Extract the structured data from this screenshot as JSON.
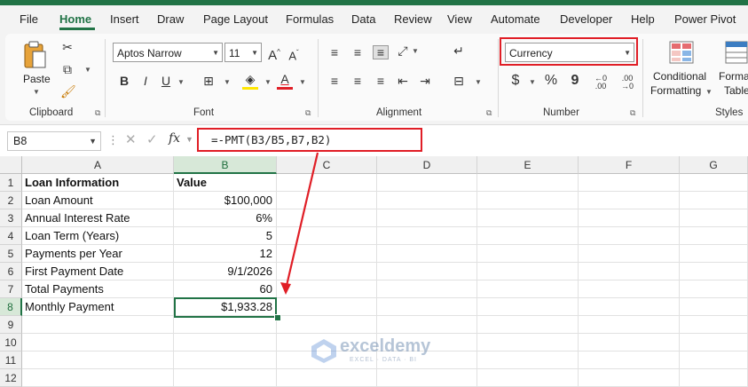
{
  "tabs": [
    "File",
    "Home",
    "Insert",
    "Draw",
    "Page Layout",
    "Formulas",
    "Data",
    "Review",
    "View",
    "Automate",
    "Developer",
    "Help",
    "Power Pivot"
  ],
  "active_tab": "Home",
  "ribbon": {
    "clipboard": {
      "label": "Clipboard",
      "paste_label": "Paste"
    },
    "font": {
      "label": "Font",
      "font_name": "Aptos Narrow",
      "font_size": "11"
    },
    "alignment": {
      "label": "Alignment"
    },
    "number": {
      "label": "Number",
      "format": "Currency",
      "currency_symbol": "$",
      "percent_symbol": "%",
      "comma_symbol": "9"
    },
    "styles": {
      "label": "Styles",
      "conditional_formatting": "Conditional",
      "conditional_formatting_2": "Formatting",
      "format_table": "Forma",
      "format_table_2": "Table"
    }
  },
  "formula_bar": {
    "name_box": "B8",
    "fx": "fx",
    "formula": "=-PMT(B3/B5,B7,B2)"
  },
  "columns": [
    "A",
    "B",
    "C",
    "D",
    "E",
    "F",
    "G"
  ],
  "rows": [
    [
      "Loan Information",
      "Value"
    ],
    [
      "Loan Amount",
      "$100,000"
    ],
    [
      "Annual Interest Rate",
      "6%"
    ],
    [
      "Loan Term (Years)",
      "5"
    ],
    [
      "Payments per Year",
      "12"
    ],
    [
      "First Payment Date",
      "9/1/2026"
    ],
    [
      "Total Payments",
      "60"
    ],
    [
      "Monthly Payment",
      "$1,933.28"
    ],
    [
      "",
      ""
    ],
    [
      "",
      ""
    ],
    [
      "",
      ""
    ],
    [
      "",
      ""
    ]
  ],
  "row_numbers": [
    "1",
    "2",
    "3",
    "4",
    "5",
    "6",
    "7",
    "8",
    "9",
    "10",
    "11",
    "12"
  ],
  "watermark": {
    "name": "exceldemy",
    "tagline": "EXCEL · DATA · BI"
  },
  "colors": {
    "excel_green": "#217346",
    "highlight_red": "#e01e26"
  }
}
